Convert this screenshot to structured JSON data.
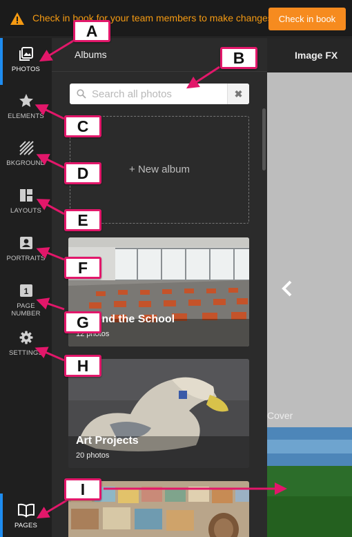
{
  "banner": {
    "message": "Check in book for your team members to make changes",
    "button_label": "Check in book",
    "icon": "warning-icon",
    "accent_color": "#f68b1f"
  },
  "sidebar": {
    "items": [
      {
        "label": "PHOTOS",
        "icon": "photos-icon"
      },
      {
        "label": "ELEMENTS",
        "icon": "star-icon"
      },
      {
        "label": "BKGROUND",
        "icon": "background-stripes-icon"
      },
      {
        "label": "LAYOUTS",
        "icon": "layouts-grid-icon"
      },
      {
        "label": "PORTRAITS",
        "icon": "portrait-icon"
      },
      {
        "label": "PAGE NUMBER",
        "icon": "page-number-icon"
      },
      {
        "label": "SETTINGS",
        "icon": "gear-icon"
      }
    ],
    "pages": {
      "label": "PAGES",
      "icon": "book-icon"
    },
    "page_number_glyph": "1",
    "active_color": "#1e8cf0"
  },
  "albums_panel": {
    "title": "Albums",
    "search_placeholder": "Search all photos",
    "clear_glyph": "✖",
    "new_album_label": "+ New album",
    "albums": [
      {
        "name": "Around the School",
        "count": "12 photos"
      },
      {
        "name": "Art Projects",
        "count": "20 photos"
      }
    ]
  },
  "right_panel": {
    "title": "Image FX",
    "cover_label": "Cover",
    "prev_glyph": "‹"
  },
  "callouts": [
    "A",
    "B",
    "C",
    "D",
    "E",
    "F",
    "G",
    "H",
    "I"
  ],
  "callout_color": "#e2176a"
}
